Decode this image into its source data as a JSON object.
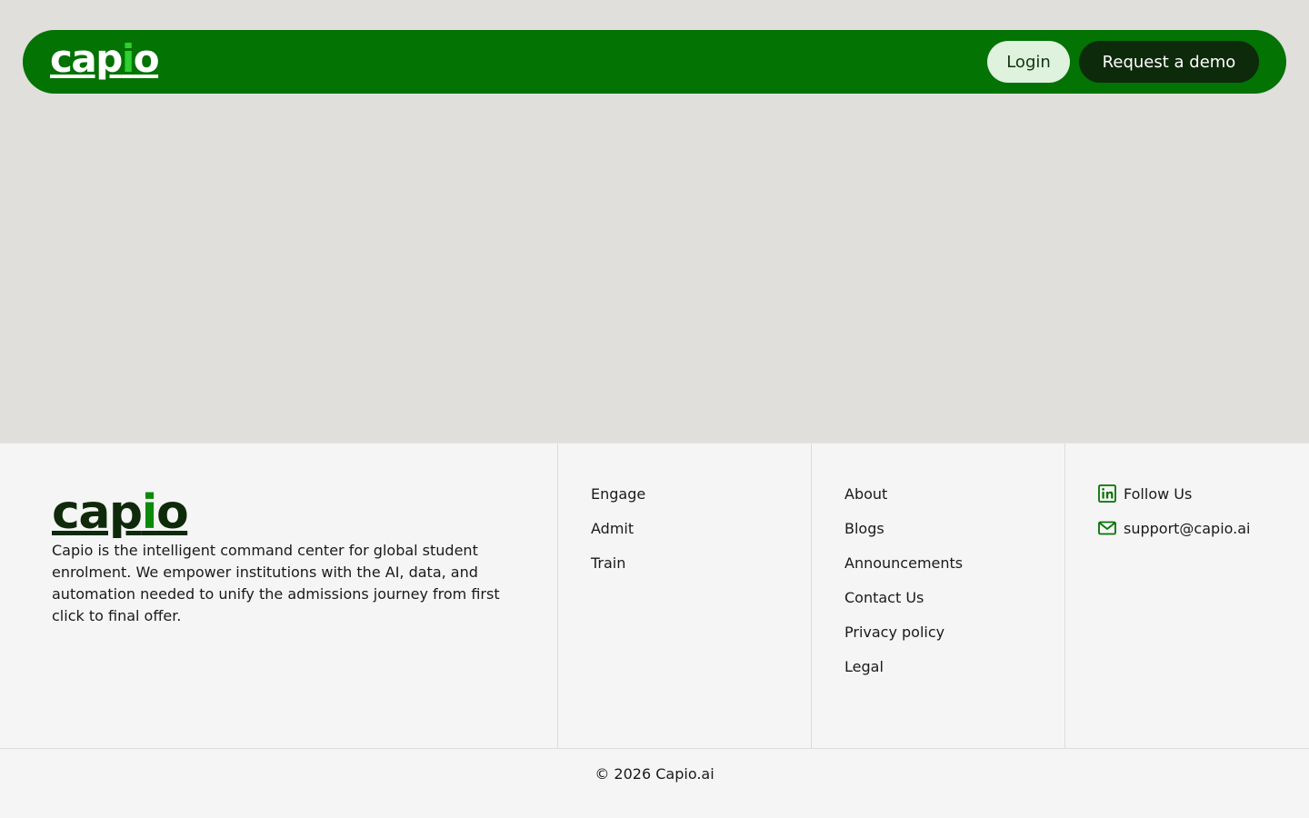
{
  "navbar": {
    "logo_text": "capio",
    "login_label": "Login",
    "demo_label": "Request a demo"
  },
  "footer": {
    "logo_text": "capio",
    "description": "Capio is the intelligent command center for global student enrolment. We empower institutions with the AI, data, and automation needed to unify the admissions journey from first click to final offer.",
    "products": [
      "Engage",
      "Admit",
      "Train"
    ],
    "company": [
      "About",
      "Blogs",
      "Announcements",
      "Contact Us",
      "Privacy policy",
      "Legal"
    ],
    "social": {
      "follow_label": "Follow Us",
      "email_label": "support@capio.ai"
    },
    "copyright": "© 2026 Capio.ai"
  },
  "colors": {
    "brand_green": "#037303",
    "dark_green": "#0d2a0b",
    "light_green": "#def2dd",
    "hero_bg": "#e0dfdb",
    "footer_bg": "#f5f5f5"
  },
  "icons": {
    "follow": "linkedin-icon",
    "email": "mail-icon"
  }
}
